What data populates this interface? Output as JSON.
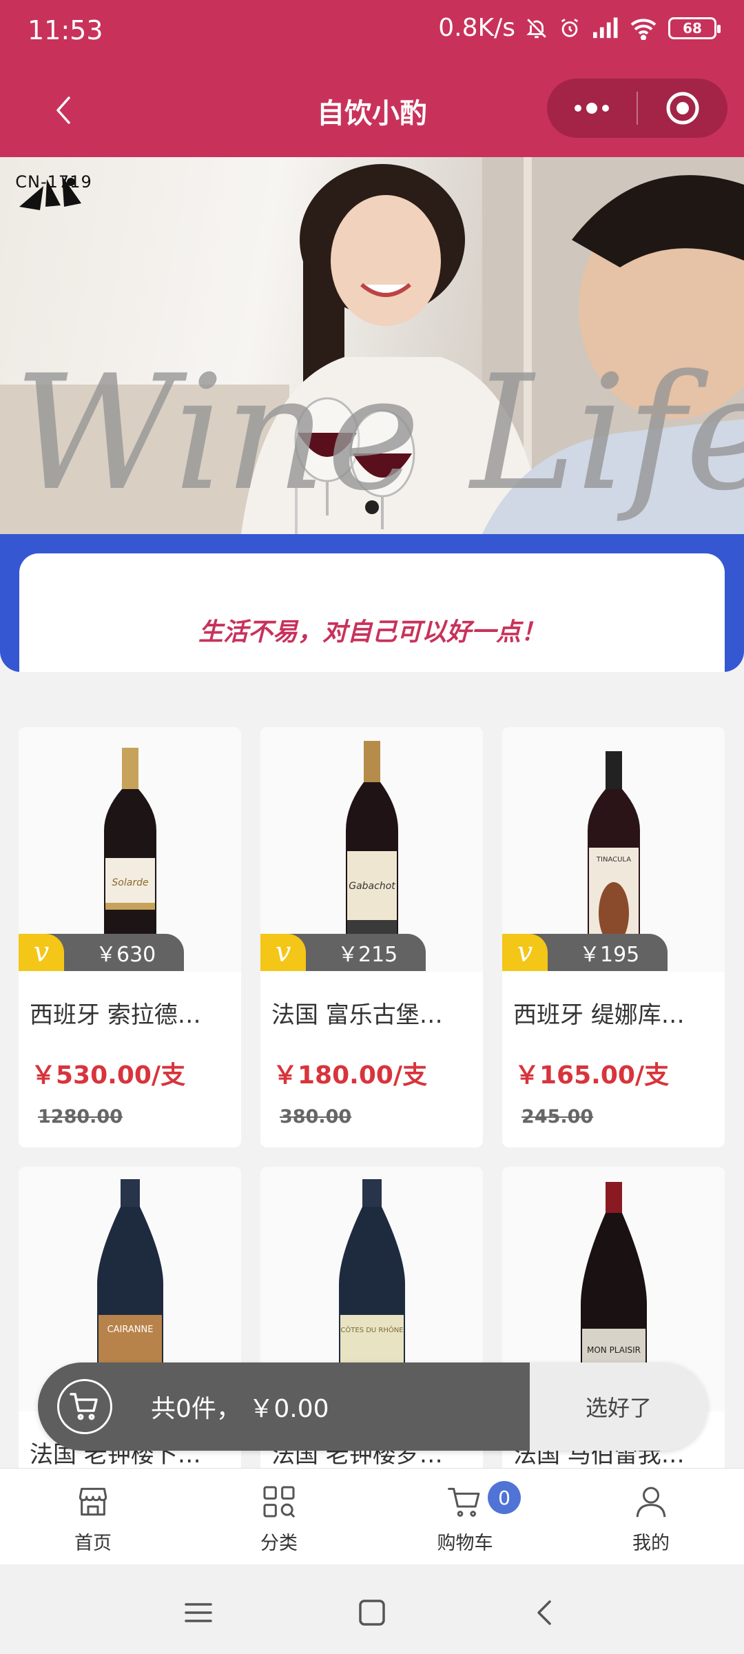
{
  "status_bar": {
    "time": "11:53",
    "net_speed": "0.8K/s",
    "battery": "68"
  },
  "nav": {
    "title": "自饮小酌",
    "back_icon": "chevron-left-icon",
    "more_icon": "more-dots-icon",
    "close_icon": "record-circle-icon"
  },
  "banner": {
    "logo_text": "CN-1719",
    "script_text": "Wine Life"
  },
  "slogan": "生活不易，对自己可以好一点！",
  "products": [
    {
      "name": "西班牙 索拉德…",
      "member_price": "￥630",
      "price": "￥530.00/支",
      "old_price": "1280.00",
      "label_text": "Solarde"
    },
    {
      "name": "法国 富乐古堡…",
      "member_price": "￥215",
      "price": "￥180.00/支",
      "old_price": "380.00",
      "label_text": "Gabachot"
    },
    {
      "name": "西班牙 缇娜库…",
      "member_price": "￥195",
      "price": "￥165.00/支",
      "old_price": "245.00",
      "label_text": "TINACULA"
    },
    {
      "name": "法国 老钟楼卜…",
      "member_price": "",
      "price": "",
      "old_price": "",
      "label_text": "CAIRANNE"
    },
    {
      "name": "法国 老钟楼罗…",
      "member_price": "",
      "price": "",
      "old_price": "",
      "label_text": "CÔTES DU RHÔNE"
    },
    {
      "name": "法国 马伯雷我…",
      "member_price": "",
      "price": "",
      "old_price": "",
      "label_text": "MON PLAISIR"
    }
  ],
  "cart": {
    "summary": "共0件， ￥0.00",
    "confirm_label": "选好了",
    "icon": "cart-icon"
  },
  "tabs": [
    {
      "label": "首页",
      "icon": "store-icon"
    },
    {
      "label": "分类",
      "icon": "category-grid-icon"
    },
    {
      "label": "购物车",
      "icon": "cart-icon",
      "badge": "0"
    },
    {
      "label": "我的",
      "icon": "user-icon"
    }
  ],
  "colors": {
    "brand": "#c8325a",
    "accent_blue": "#3557d2",
    "price_red": "#d8343c",
    "vip_yellow": "#f3c617"
  }
}
